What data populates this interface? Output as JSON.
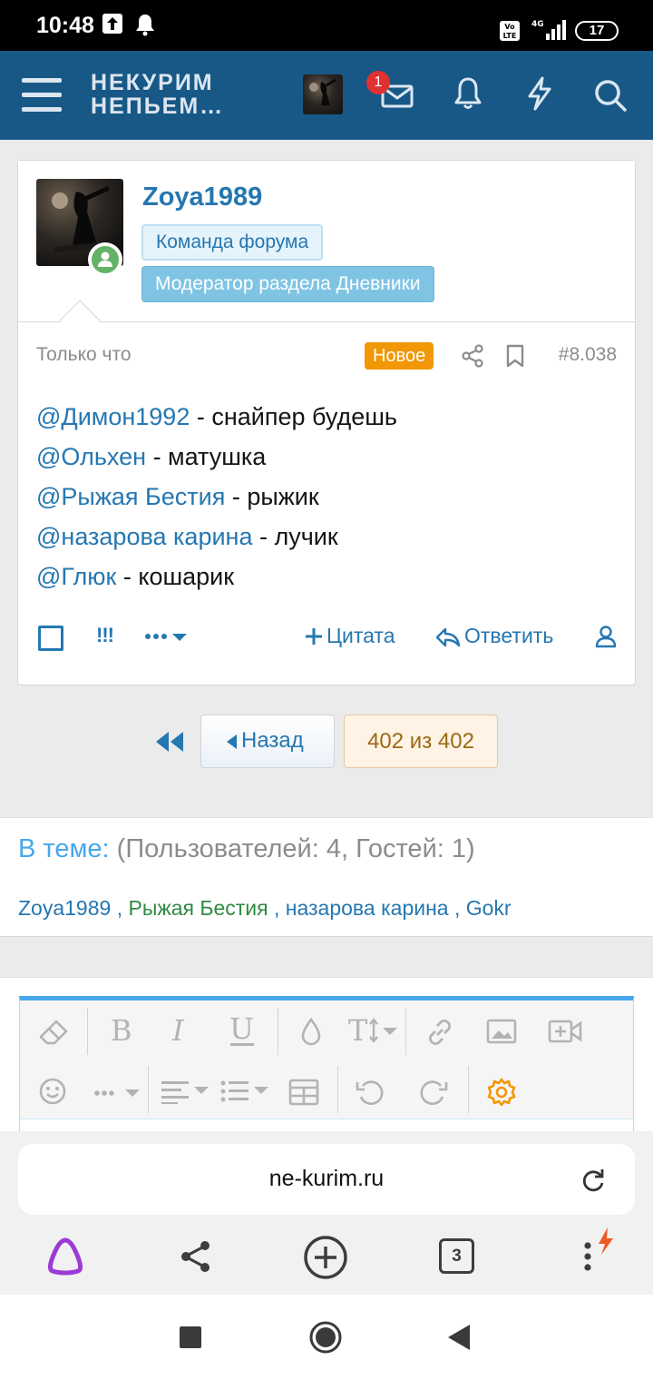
{
  "status_bar": {
    "time": "10:48",
    "network": "4G",
    "volte": "Vo LTE",
    "battery": "17"
  },
  "header": {
    "logo_line1": "НЕКУРИМ",
    "logo_line2": "НЕПЬЕМ…",
    "inbox_badge": "1"
  },
  "post": {
    "username": "Zoya1989",
    "banner_team": "Команда форума",
    "banner_moderator": "Модератор раздела Дневники",
    "date": "Только что",
    "new_badge": "Новое",
    "number": "#8.038",
    "lines": [
      {
        "mention": "@Димон1992",
        "text": " - снайпер будешь"
      },
      {
        "mention": "@Ольхен",
        "text": " - матушка"
      },
      {
        "mention": "@Рыжая Бестия",
        "text": " - рыжик"
      },
      {
        "mention": "@назарова карина",
        "text": " - лучик"
      },
      {
        "mention": "@Глюк",
        "text": " - кошарик"
      }
    ],
    "actions": {
      "report": "!!!",
      "quote": "Цитата",
      "reply": "Ответить"
    }
  },
  "pager": {
    "back": "Назад",
    "current": "402 из 402"
  },
  "online": {
    "title": "В теме:",
    "counts": " (Пользователей: 4, Гостей: 1)",
    "users": [
      "Zoya1989",
      "Рыжая Бестия",
      "назарова карина",
      "Gokr"
    ],
    "separator": " , "
  },
  "browser": {
    "url": "ne-kurim.ru",
    "tabs": "3"
  },
  "colors": {
    "header": "#185886",
    "link": "#2577b1",
    "new_badge": "#f29705",
    "accent": "#47a7eb"
  }
}
